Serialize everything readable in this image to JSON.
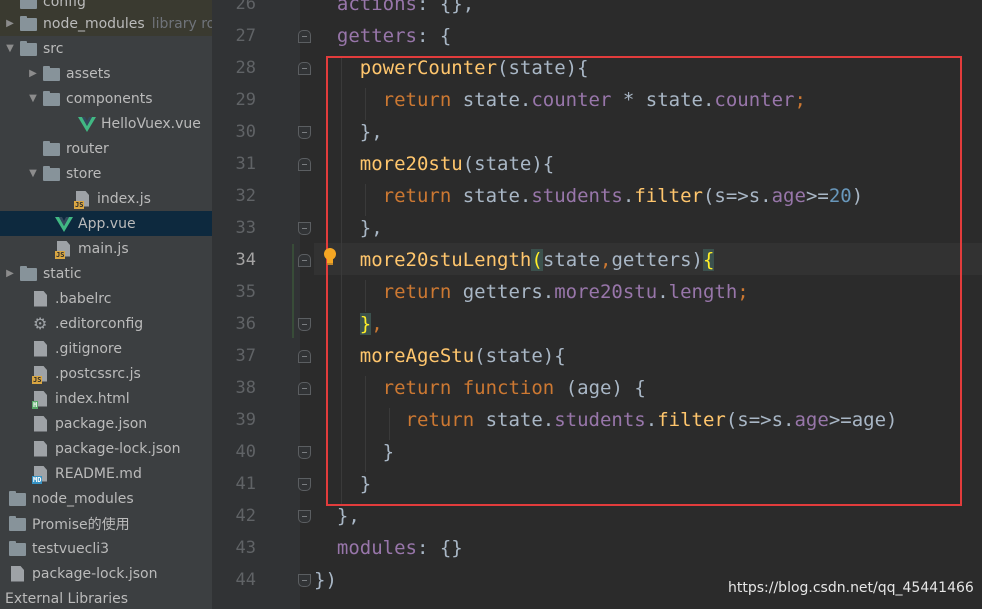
{
  "project_tree": {
    "items": [
      {
        "label": "config",
        "arrow": "",
        "icon": "folder-icon"
      },
      {
        "label": "node_modules",
        "hint": "library root",
        "arrow": "▶",
        "icon": "folder-icon"
      },
      {
        "label": "src",
        "arrow": "▼",
        "icon": "folder-icon"
      },
      {
        "label": "assets",
        "arrow": "▶",
        "icon": "folder-icon"
      },
      {
        "label": "components",
        "arrow": "▼",
        "icon": "folder-icon"
      },
      {
        "label": "HelloVuex.vue",
        "arrow": "",
        "icon": "vue-file-icon"
      },
      {
        "label": "router",
        "arrow": "",
        "icon": "folder-icon"
      },
      {
        "label": "store",
        "arrow": "▼",
        "icon": "folder-icon"
      },
      {
        "label": "index.js",
        "arrow": "",
        "icon": "js-file-icon"
      },
      {
        "label": "App.vue",
        "arrow": "",
        "icon": "vue-file-icon"
      },
      {
        "label": "main.js",
        "arrow": "",
        "icon": "js-file-icon"
      },
      {
        "label": "static",
        "arrow": "▶",
        "icon": "folder-icon"
      },
      {
        "label": ".babelrc",
        "arrow": "",
        "icon": "config-file-icon"
      },
      {
        "label": ".editorconfig",
        "arrow": "",
        "icon": "gear-icon"
      },
      {
        "label": ".gitignore",
        "arrow": "",
        "icon": "file-icon"
      },
      {
        "label": ".postcssrc.js",
        "arrow": "",
        "icon": "js-file-icon"
      },
      {
        "label": "index.html",
        "arrow": "",
        "icon": "html-file-icon"
      },
      {
        "label": "package.json",
        "arrow": "",
        "icon": "config-file-icon"
      },
      {
        "label": "package-lock.json",
        "arrow": "",
        "icon": "config-file-icon"
      },
      {
        "label": "README.md",
        "arrow": "",
        "icon": "md-file-icon"
      },
      {
        "label": "node_modules",
        "arrow": "",
        "icon": "folder-icon"
      },
      {
        "label": "Promise的使用",
        "arrow": "",
        "icon": "folder-icon"
      },
      {
        "label": "testvuecli3",
        "arrow": "",
        "icon": "folder-icon"
      },
      {
        "label": "package-lock.json",
        "arrow": "",
        "icon": "config-file-icon"
      },
      {
        "label": "External Libraries",
        "arrow": "",
        "icon": ""
      }
    ]
  },
  "editor": {
    "line_numbers": [
      "26",
      "27",
      "28",
      "29",
      "30",
      "31",
      "32",
      "33",
      "34",
      "35",
      "36",
      "37",
      "38",
      "39",
      "40",
      "41",
      "42",
      "43",
      "44"
    ],
    "current_line": "34",
    "code": [
      {
        "n": "26",
        "tokens": [
          {
            "t": "  actions",
            "c": "t-prop"
          },
          {
            "t": ": {},",
            "c": "t-plain"
          }
        ]
      },
      {
        "n": "27",
        "tokens": [
          {
            "t": "  getters",
            "c": "t-prop"
          },
          {
            "t": ": {",
            "c": "t-plain"
          }
        ]
      },
      {
        "n": "28",
        "tokens": [
          {
            "t": "    ",
            "c": "t-plain"
          },
          {
            "t": "powerCounter",
            "c": "t-fn"
          },
          {
            "t": "(state){",
            "c": "t-plain"
          }
        ]
      },
      {
        "n": "29",
        "tokens": [
          {
            "t": "      ",
            "c": "t-plain"
          },
          {
            "t": "return",
            "c": "t-kw"
          },
          {
            "t": " state.",
            "c": "t-plain"
          },
          {
            "t": "counter",
            "c": "t-prop"
          },
          {
            "t": " * state.",
            "c": "t-plain"
          },
          {
            "t": "counter",
            "c": "t-prop"
          },
          {
            "t": ";",
            "c": "t-kw"
          }
        ]
      },
      {
        "n": "30",
        "tokens": [
          {
            "t": "    },",
            "c": "t-plain"
          }
        ]
      },
      {
        "n": "31",
        "tokens": [
          {
            "t": "    ",
            "c": "t-plain"
          },
          {
            "t": "more20stu",
            "c": "t-fn"
          },
          {
            "t": "(state){",
            "c": "t-plain"
          }
        ]
      },
      {
        "n": "32",
        "tokens": [
          {
            "t": "      ",
            "c": "t-plain"
          },
          {
            "t": "return",
            "c": "t-kw"
          },
          {
            "t": " state.",
            "c": "t-plain"
          },
          {
            "t": "students",
            "c": "t-prop"
          },
          {
            "t": ".",
            "c": "t-plain"
          },
          {
            "t": "filter",
            "c": "t-fn"
          },
          {
            "t": "(s=>s.",
            "c": "t-plain"
          },
          {
            "t": "age",
            "c": "t-prop"
          },
          {
            "t": ">=",
            "c": "t-plain"
          },
          {
            "t": "20",
            "c": "t-num"
          },
          {
            "t": ")",
            "c": "t-plain"
          }
        ]
      },
      {
        "n": "33",
        "tokens": [
          {
            "t": "    },",
            "c": "t-plain"
          }
        ]
      },
      {
        "n": "34",
        "tokens": [
          {
            "t": "    ",
            "c": "t-plain"
          },
          {
            "t": "more20stuLength",
            "c": "t-fn"
          },
          {
            "t": "(",
            "c": "t-brace-hl"
          },
          {
            "t": "state",
            "c": "t-plain"
          },
          {
            "t": ",",
            "c": "t-kw"
          },
          {
            "t": "getters",
            "c": "t-plain"
          },
          {
            "t": ")",
            "c": "t-plain"
          },
          {
            "t": "{",
            "c": "t-brace-hl"
          }
        ]
      },
      {
        "n": "35",
        "tokens": [
          {
            "t": "      ",
            "c": "t-plain"
          },
          {
            "t": "return",
            "c": "t-kw"
          },
          {
            "t": " getters.",
            "c": "t-plain"
          },
          {
            "t": "more20stu",
            "c": "t-prop"
          },
          {
            "t": ".",
            "c": "t-plain"
          },
          {
            "t": "length",
            "c": "t-prop"
          },
          {
            "t": ";",
            "c": "t-kw"
          }
        ]
      },
      {
        "n": "36",
        "tokens": [
          {
            "t": "    ",
            "c": "t-plain"
          },
          {
            "t": "}",
            "c": "t-brace-hl"
          },
          {
            "t": ",",
            "c": "t-kw"
          }
        ]
      },
      {
        "n": "37",
        "tokens": [
          {
            "t": "    ",
            "c": "t-plain"
          },
          {
            "t": "moreAgeStu",
            "c": "t-fn"
          },
          {
            "t": "(state){",
            "c": "t-plain"
          }
        ]
      },
      {
        "n": "38",
        "tokens": [
          {
            "t": "      ",
            "c": "t-plain"
          },
          {
            "t": "return",
            "c": "t-kw"
          },
          {
            "t": " ",
            "c": "t-plain"
          },
          {
            "t": "function",
            "c": "t-kw"
          },
          {
            "t": " (age) {",
            "c": "t-plain"
          }
        ]
      },
      {
        "n": "39",
        "tokens": [
          {
            "t": "        ",
            "c": "t-plain"
          },
          {
            "t": "return",
            "c": "t-kw"
          },
          {
            "t": " state.",
            "c": "t-plain"
          },
          {
            "t": "students",
            "c": "t-prop"
          },
          {
            "t": ".",
            "c": "t-plain"
          },
          {
            "t": "filter",
            "c": "t-fn"
          },
          {
            "t": "(s=>s.",
            "c": "t-plain"
          },
          {
            "t": "age",
            "c": "t-prop"
          },
          {
            "t": ">=age)",
            "c": "t-plain"
          }
        ]
      },
      {
        "n": "40",
        "tokens": [
          {
            "t": "      }",
            "c": "t-plain"
          }
        ]
      },
      {
        "n": "41",
        "tokens": [
          {
            "t": "    }",
            "c": "t-plain"
          }
        ]
      },
      {
        "n": "42",
        "tokens": [
          {
            "t": "  },",
            "c": "t-plain"
          }
        ]
      },
      {
        "n": "43",
        "tokens": [
          {
            "t": "  modules",
            "c": "t-prop"
          },
          {
            "t": ": {}",
            "c": "t-plain"
          }
        ]
      },
      {
        "n": "44",
        "tokens": [
          {
            "t": "})",
            "c": "t-plain"
          }
        ]
      }
    ]
  },
  "watermark": "https://blog.csdn.net/qq_45441466",
  "colors": {
    "highlight_box": "#e23c3c",
    "keyword": "#cc7832",
    "function": "#ffc66d",
    "property": "#9876aa",
    "number": "#6897bb",
    "plain": "#a9b7c6"
  }
}
